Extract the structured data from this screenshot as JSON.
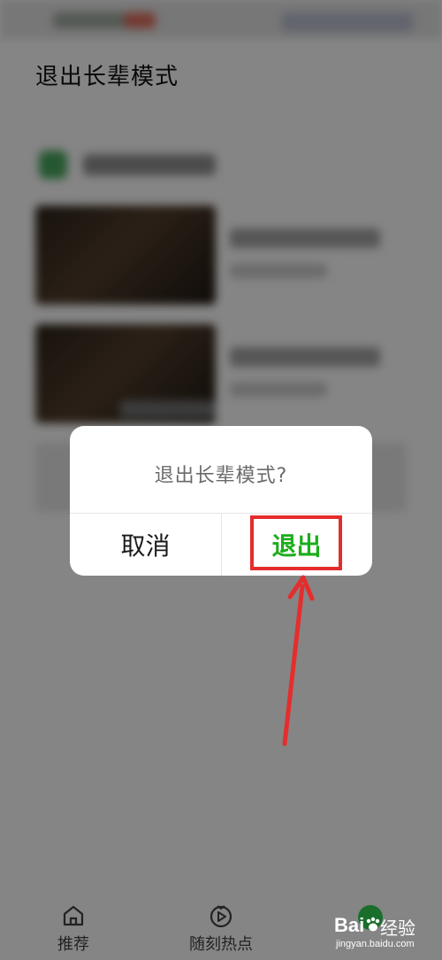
{
  "page": {
    "title": "退出长辈模式"
  },
  "dialog": {
    "message": "退出长辈模式?",
    "cancel_label": "取消",
    "confirm_label": "退出"
  },
  "tabbar": {
    "items": [
      {
        "label": "推荐",
        "icon": "home-icon"
      },
      {
        "label": "随刻热点",
        "icon": "play-icon"
      }
    ]
  },
  "watermark": {
    "brand": "Bai",
    "suffix": "经验",
    "url": "jingyan.baidu.com"
  },
  "colors": {
    "accent": "#1aad19",
    "highlight": "#e52d2d",
    "overlay": "rgba(0,0,0,0.45)"
  }
}
